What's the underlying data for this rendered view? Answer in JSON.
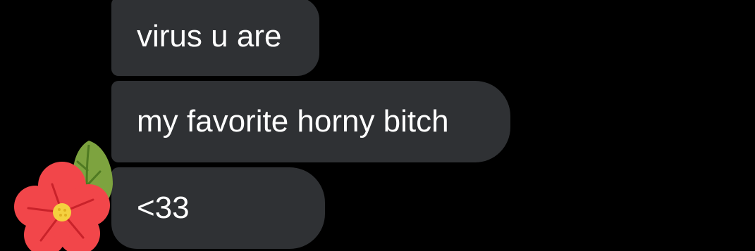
{
  "messages": [
    {
      "text": "virus u are"
    },
    {
      "text": "my favorite horny bitch"
    },
    {
      "text": "<33"
    }
  ],
  "avatar": {
    "icon": "flower-sticker-icon",
    "colors": {
      "petal": "#f2464a",
      "petal_line": "#c9222a",
      "center": "#f4d03f",
      "leaf": "#7da33f",
      "leaf_vein": "#4f7a22"
    }
  },
  "colors": {
    "background": "#000000",
    "bubble": "#2f3134",
    "text": "#ffffff"
  }
}
